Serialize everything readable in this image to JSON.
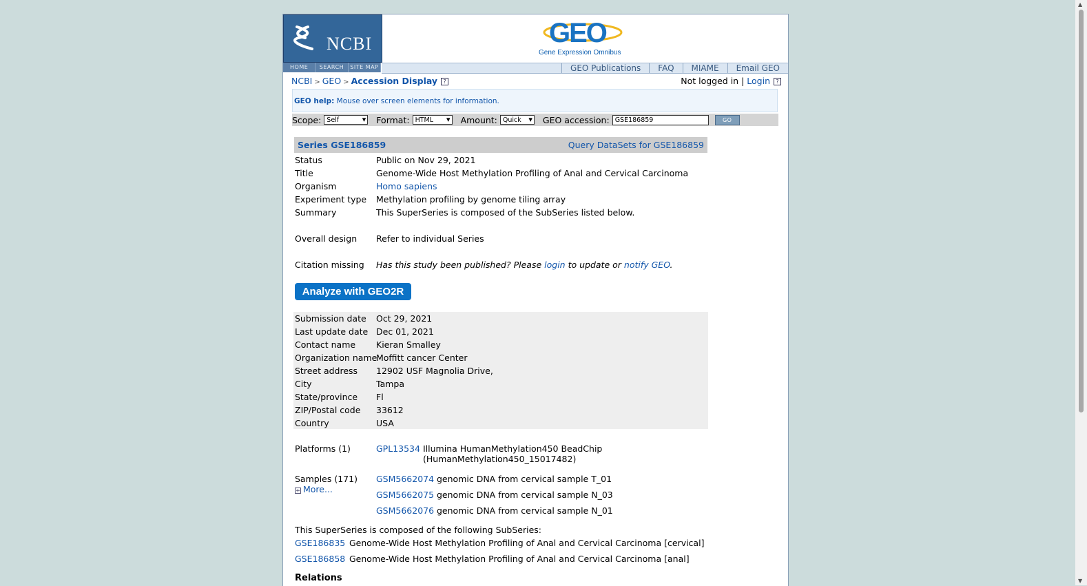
{
  "header": {
    "ncbi_word": "NCBI",
    "ncbi_nav": [
      "HOME",
      "SEARCH",
      "SITE MAP"
    ],
    "geo_subtitle": "Gene Expression Omnibus",
    "top_links": [
      "GEO Publications",
      "FAQ",
      "MIAME",
      "Email GEO"
    ]
  },
  "breadcrumb": {
    "items": [
      "NCBI",
      "GEO"
    ],
    "current": "Accession Display"
  },
  "login": {
    "status": "Not logged in",
    "login_label": "Login"
  },
  "help": {
    "label": "GEO help:",
    "text": "Mouse over screen elements for information."
  },
  "query": {
    "scope_label": "Scope:",
    "scope_value": "Self",
    "format_label": "Format:",
    "format_value": "HTML",
    "amount_label": "Amount:",
    "amount_value": "Quick",
    "accession_label": "GEO accession:",
    "accession_value": "GSE186859",
    "go_label": "GO"
  },
  "series": {
    "title": "Series GSE186859",
    "query_link": "Query DataSets for GSE186859"
  },
  "details": {
    "status_k": "Status",
    "status_v": "Public on Nov 29, 2021",
    "title_k": "Title",
    "title_v": "Genome-Wide Host Methylation Profiling of Anal and Cervical Carcinoma",
    "organism_k": "Organism",
    "organism_v": "Homo sapiens",
    "exptype_k": "Experiment type",
    "exptype_v": "Methylation profiling by genome tiling array",
    "summary_k": "Summary",
    "summary_v": "This SuperSeries is composed of the SubSeries listed below.",
    "design_k": "Overall design",
    "design_v": "Refer to individual Series",
    "citation_k": "Citation missing",
    "citation_pre": "Has this study been published? Please",
    "citation_login": "login",
    "citation_mid": "to update or",
    "citation_notify": "notify GEO",
    "citation_end": "."
  },
  "geo2r_label": "Analyze with GEO2R",
  "contact": {
    "submission_k": "Submission date",
    "submission_v": "Oct 29, 2021",
    "update_k": "Last update date",
    "update_v": "Dec 01, 2021",
    "name_k": "Contact name",
    "name_v": "Kieran Smalley",
    "org_k": "Organization name",
    "org_v": "Moffitt cancer Center",
    "street_k": "Street address",
    "street_v": "12902 USF Magnolia Drive,",
    "city_k": "City",
    "city_v": "Tampa",
    "state_k": "State/province",
    "state_v": "Fl",
    "zip_k": "ZIP/Postal code",
    "zip_v": "33612",
    "country_k": "Country",
    "country_v": "USA"
  },
  "platforms": {
    "label": "Platforms (1)",
    "id": "GPL13534",
    "line1": "Illumina HumanMethylation450 BeadChip",
    "line2": "(HumanMethylation450_15017482)"
  },
  "samples": {
    "label": "Samples (171)",
    "more": "More...",
    "items": [
      {
        "id": "GSM5662074",
        "desc": "genomic DNA from cervical sample T_01"
      },
      {
        "id": "GSM5662075",
        "desc": "genomic DNA from cervical sample N_03"
      },
      {
        "id": "GSM5662076",
        "desc": "genomic DNA from cervical sample N_01"
      }
    ]
  },
  "subseries": {
    "intro": "This SuperSeries is composed of the following SubSeries:",
    "items": [
      {
        "id": "GSE186835",
        "desc": "Genome-Wide Host Methylation Profiling of Anal and Cervical Carcinoma [cervical]"
      },
      {
        "id": "GSE186858",
        "desc": "Genome-Wide Host Methylation Profiling of Anal and Cervical Carcinoma [anal]"
      }
    ]
  },
  "relations_label": "Relations",
  "colors": {
    "link": "#1155aa",
    "ncbi_blue": "#336699",
    "geo2r_button": "#0b72c6",
    "page_bg": "#ccdcdc"
  }
}
